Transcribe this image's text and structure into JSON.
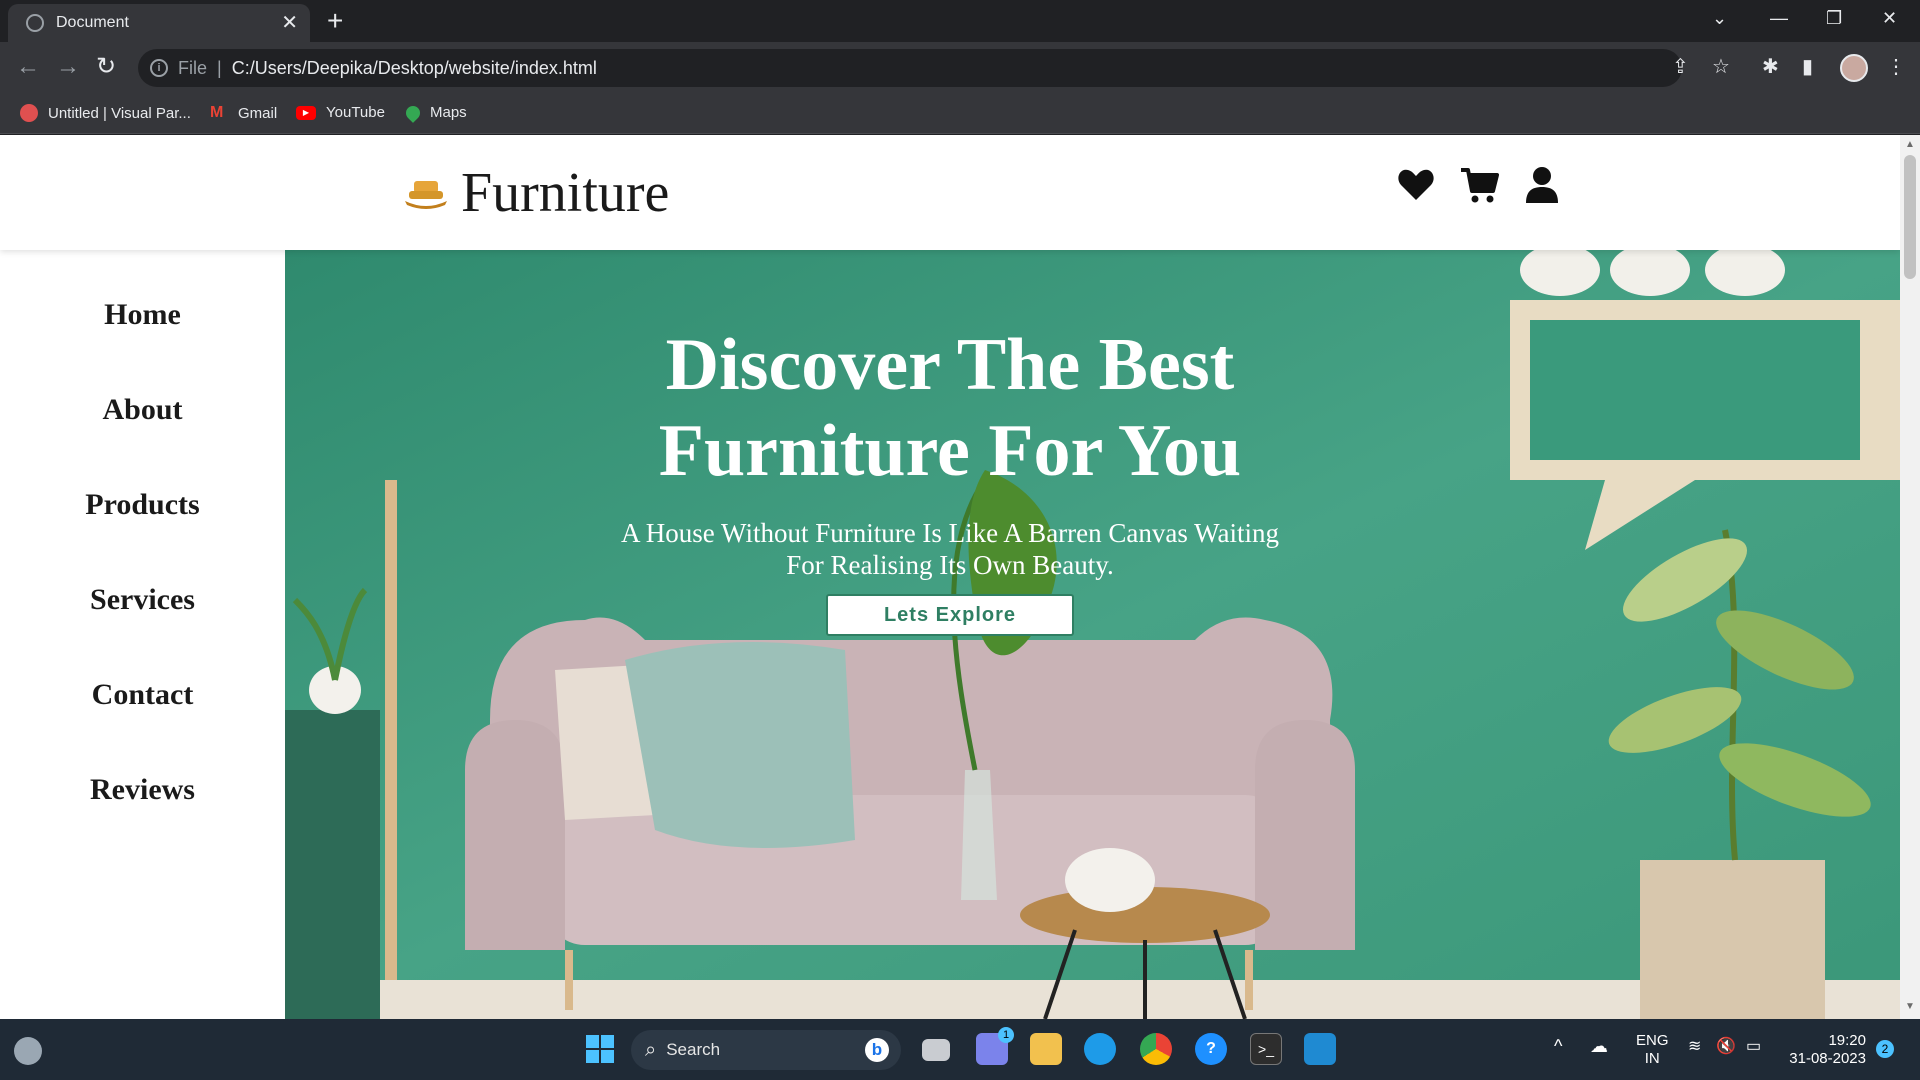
{
  "browser": {
    "tab_title": "Document",
    "address_scheme": "File",
    "address_url": "C:/Users/Deepika/Desktop/website/index.html",
    "bookmarks": [
      {
        "label": "Untitled | Visual Par...",
        "icon": "visual-paradigm-icon",
        "color": "#e05050"
      },
      {
        "label": "Gmail",
        "icon": "gmail-icon",
        "color": "#ea4335"
      },
      {
        "label": "YouTube",
        "icon": "youtube-icon",
        "color": "#ff0000"
      },
      {
        "label": "Maps",
        "icon": "maps-icon",
        "color": "#34a853"
      }
    ]
  },
  "site": {
    "logo_text": "Furniture",
    "header_icons": [
      "heart-icon",
      "cart-icon",
      "user-icon"
    ],
    "nav": [
      "Home",
      "About",
      "Products",
      "Services",
      "Contact",
      "Reviews"
    ],
    "hero": {
      "title_line1": "Discover The Best",
      "title_line2": "Furniture For You",
      "subtitle_line1": "A House Without Furniture Is Like A Barren Canvas Waiting",
      "subtitle_line2": "For Realising Its Own Beauty.",
      "button": "Lets Explore"
    },
    "colors": {
      "accent": "#2f7f63",
      "hero_bg": "#3a9a7c",
      "logo": "#d4962a"
    }
  },
  "taskbar": {
    "search_label": "Search",
    "language_line1": "ENG",
    "language_line2": "IN",
    "time": "19:20",
    "date": "31-08-2023",
    "notification_count": "2",
    "teams_badge": "1"
  }
}
